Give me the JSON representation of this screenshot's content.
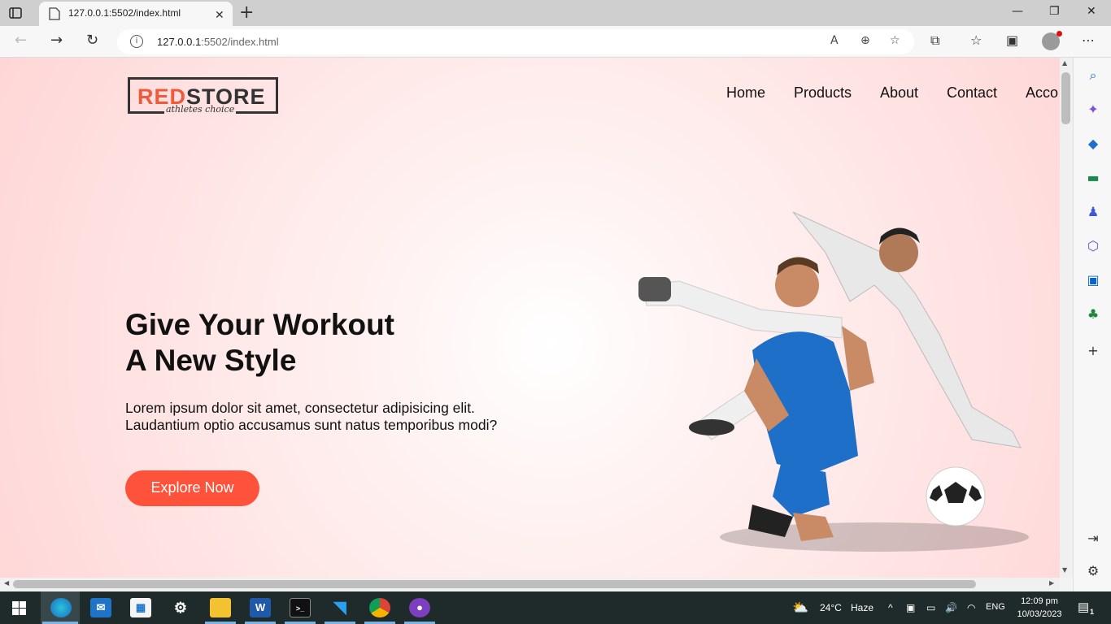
{
  "browser": {
    "tab_title": "127.0.0.1:5502/index.html",
    "url_host": "127.0.0.1",
    "url_rest": ":5502/index.html"
  },
  "site": {
    "logo_red": "RED",
    "logo_dark": "STORE",
    "logo_tagline": "athletes choice",
    "nav": [
      "Home",
      "Products",
      "About",
      "Contact",
      "Acco"
    ],
    "hero_title_line1": "Give Your Workout",
    "hero_title_line2": "A New Style",
    "hero_text_line1": "Lorem ipsum dolor sit amet, consectetur adipisicing elit.",
    "hero_text_line2": "Laudantium optio accusamus sunt natus temporibus modi?",
    "cta_label": "Explore Now",
    "accent": "#ff523b"
  },
  "taskbar": {
    "weather_temp": "24°C",
    "weather_desc": "Haze",
    "language": "ENG",
    "time": "12:09 pm",
    "date": "10/03/2023",
    "notification_count": "1"
  }
}
